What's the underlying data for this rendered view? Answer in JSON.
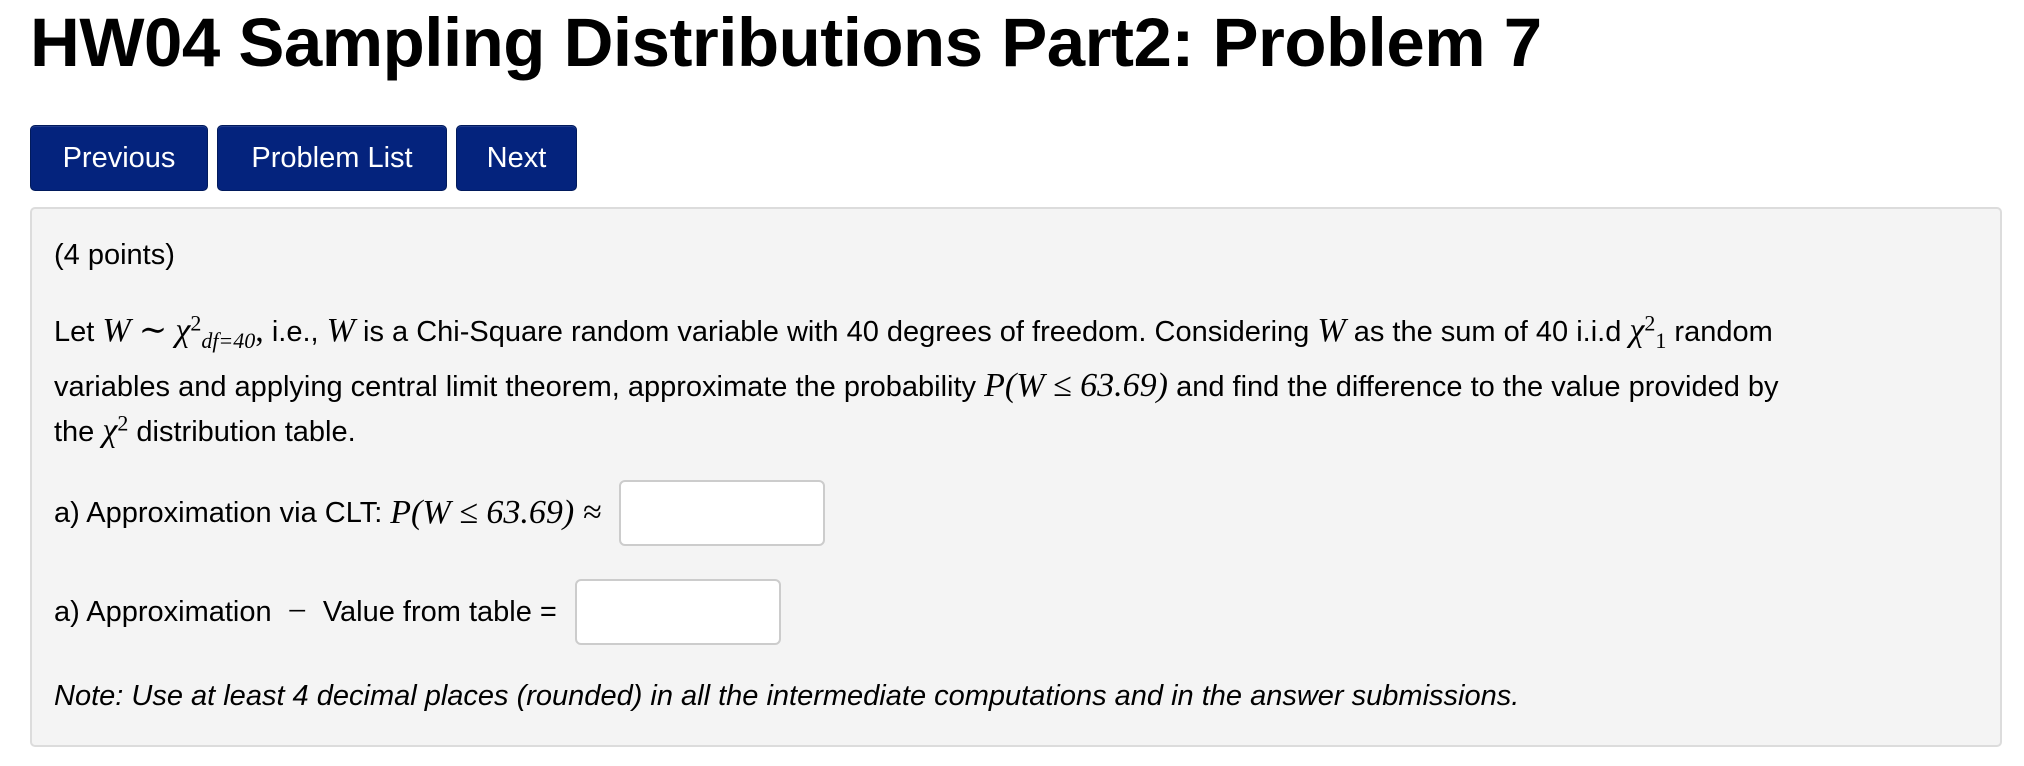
{
  "header": {
    "title": "HW04 Sampling Distributions Part2: Problem 7"
  },
  "nav": {
    "previous_label": "Previous",
    "problem_list_label": "Problem List",
    "next_label": "Next"
  },
  "problem": {
    "points": "(4 points)",
    "intro": {
      "let": "Let",
      "var_w": "W",
      "tilde": "∼",
      "chi": "χ",
      "sup2": "2",
      "df_sub": "df=40",
      "comma": ",",
      "text_ie": "i.e.,",
      "text_chisq": "is a Chi-Square random variable with 40 degrees of freedom. Considering",
      "text_sum": "as the sum of 40 i.i.d",
      "sub1": "1",
      "text_random": "random",
      "line2_a": "variables and applying central limit theorem, approximate the probability",
      "prob_expr": "P(W ≤ 63.69)",
      "line2_b": "and find the difference to the value provided by",
      "line3_the": "the",
      "line3_rest": "distribution table."
    },
    "part_a": {
      "label": "a) Approximation via CLT:",
      "expr": "P(W ≤ 63.69) ≈",
      "input_value": ""
    },
    "part_b": {
      "label_left": "a) Approximation",
      "minus": "−",
      "label_right": "Value from table =",
      "input_value": ""
    },
    "note": "Note: Use at least 4 decimal places (rounded) in all the intermediate computations and in the answer submissions."
  },
  "colors": {
    "button_bg": "#04237d",
    "panel_bg": "#f4f4f4",
    "panel_border": "#dcdcdc"
  }
}
